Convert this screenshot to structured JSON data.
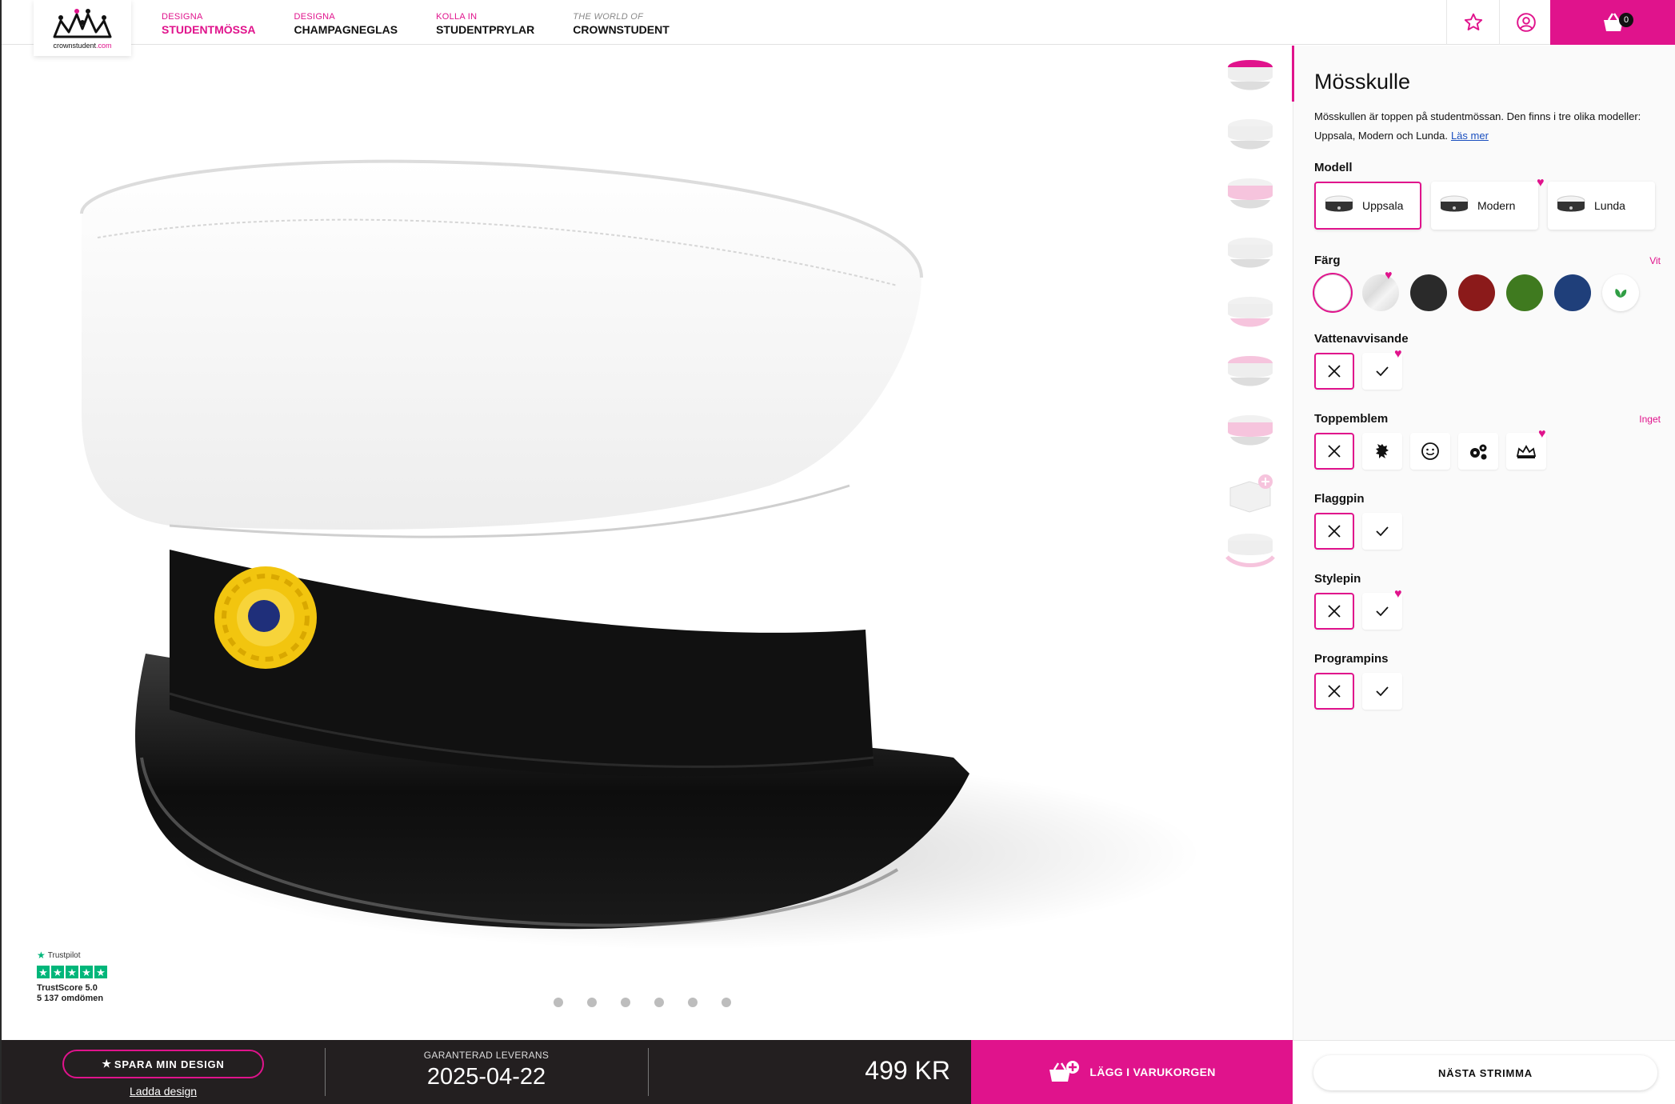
{
  "header": {
    "logo_text_a": "crownstudent",
    "logo_text_b": ".com",
    "nav": [
      {
        "small": "DESIGNA",
        "big": "STUDENTMÖSSA"
      },
      {
        "small": "DESIGNA",
        "big": "CHAMPAGNEGLAS"
      },
      {
        "small": "KOLLA IN",
        "big": "STUDENTPRYLAR"
      },
      {
        "small": "THE WORLD OF",
        "big": "CROWNSTUDENT"
      }
    ],
    "cart_count": "0",
    "accent_color": "#e0138c"
  },
  "viewer": {
    "trustpilot": {
      "name": "Trustpilot",
      "score": "TrustScore 5.0",
      "reviews": "5 137 omdömen"
    },
    "carousel_dot_count": 6
  },
  "panel": {
    "title": "Mösskulle",
    "description": "Mösskullen är toppen på studentmössan. Den finns i tre olika modeller: Uppsala, Modern och Lunda.",
    "read_more": "Läs mer",
    "model": {
      "label": "Modell",
      "options": [
        "Uppsala",
        "Modern",
        "Lunda"
      ],
      "selected": "Uppsala"
    },
    "color": {
      "label": "Färg",
      "value": "Vit",
      "swatches": [
        "#ffffff",
        "#e8e8e8",
        "#2a2a2a",
        "#8b1a1a",
        "#3f7a1f",
        "#1f3f7a",
        "#ffffff"
      ]
    },
    "water": {
      "label": "Vattenavvisande"
    },
    "emblem": {
      "label": "Toppemblem",
      "value": "Inget",
      "icons": [
        "close-icon",
        "lion-icon",
        "smiley-icon",
        "gears-icon",
        "crown-icon"
      ]
    },
    "flag": {
      "label": "Flaggpin"
    },
    "style": {
      "label": "Stylepin"
    },
    "program": {
      "label": "Programpins"
    }
  },
  "footer": {
    "save": "SPARA MIN DESIGN",
    "load": "Ladda design",
    "delivery_label": "GARANTERAD LEVERANS",
    "delivery_date": "2025-04-22",
    "price": "499 KR",
    "add_to_cart": "LÄGG I VARUKORGEN",
    "next": "NÄSTA STRIMMA"
  }
}
